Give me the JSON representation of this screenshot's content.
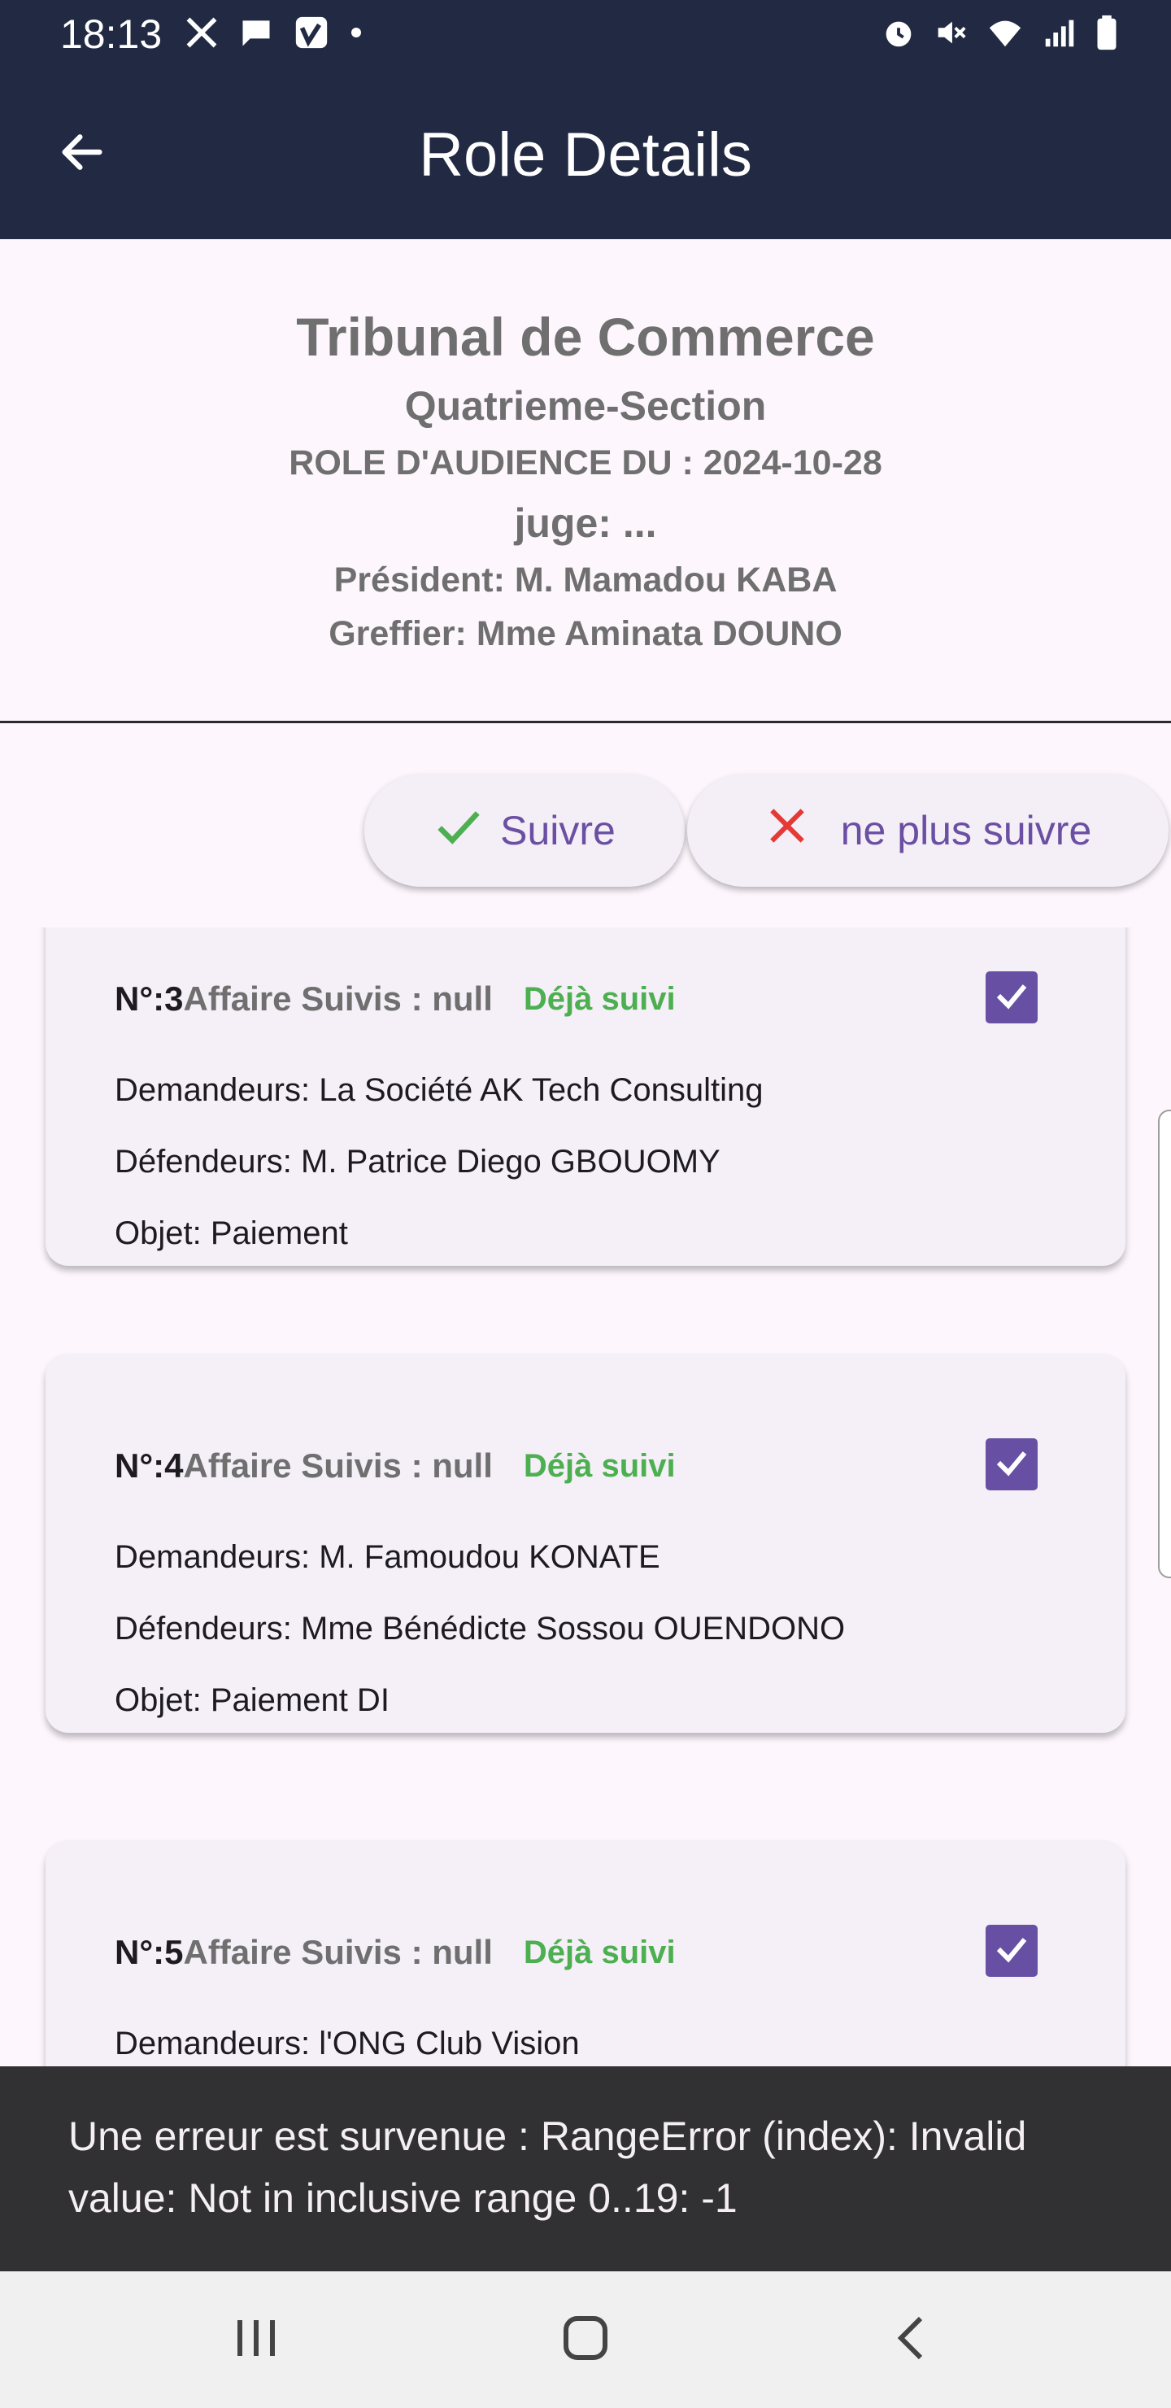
{
  "status_bar": {
    "time": "18:13",
    "left_icons": [
      "x-icon",
      "chat-icon",
      "vimeo-icon",
      "dot-icon"
    ],
    "right_icons": [
      "alarm-icon",
      "mute-icon",
      "wifi-icon",
      "signal-icon",
      "battery-icon"
    ]
  },
  "app_bar": {
    "title": "Role Details",
    "back_icon": "arrow-left-icon"
  },
  "header": {
    "court": "Tribunal de Commerce",
    "section": "Quatrieme-Section",
    "role_date": "ROLE D'AUDIENCE DU : 2024-10-28",
    "juge": "juge: ...",
    "president": "Président: M. Mamadou KABA",
    "greffier": "Greffier: Mme Aminata DOUNO"
  },
  "actions": {
    "follow_label": "Suivre",
    "unfollow_label": "ne plus suivre",
    "follow_color": "#4caf50",
    "unfollow_color": "#e53935"
  },
  "cards": [
    {
      "num_label": "N°: ",
      "num": "3",
      "affaire": "Affaire Suivis : null",
      "status": "Déjà suivi",
      "checked": true,
      "demandeurs": "Demandeurs: La Société AK Tech Consulting",
      "defendeurs": "Défendeurs: M. Patrice Diego GBOUOMY",
      "objet": "Objet: Paiement"
    },
    {
      "num_label": "N°: ",
      "num": "4",
      "affaire": "Affaire Suivis : null",
      "status": "Déjà suivi",
      "checked": true,
      "demandeurs": "Demandeurs: M. Famoudou KONATE",
      "defendeurs": "Défendeurs: Mme Bénédicte Sossou OUENDONO",
      "objet": "Objet: Paiement DI"
    },
    {
      "num_label": "N°: ",
      "num": "5",
      "affaire": "Affaire Suivis : null",
      "status": "Déjà suivi",
      "checked": true,
      "demandeurs": "Demandeurs: l'ONG Club Vision",
      "defendeurs": "",
      "objet": ""
    }
  ],
  "snackbar": {
    "message": "Une erreur est survenue : RangeError (index): Invalid value: Not in inclusive range 0..19: -1"
  },
  "nav_bar": {
    "buttons": [
      "recent-apps-icon",
      "home-icon",
      "back-icon"
    ]
  },
  "colors": {
    "app_bar": "#212a42",
    "accent": "#6750a4",
    "followed_green": "#4caf50",
    "snackbar": "#313033"
  }
}
